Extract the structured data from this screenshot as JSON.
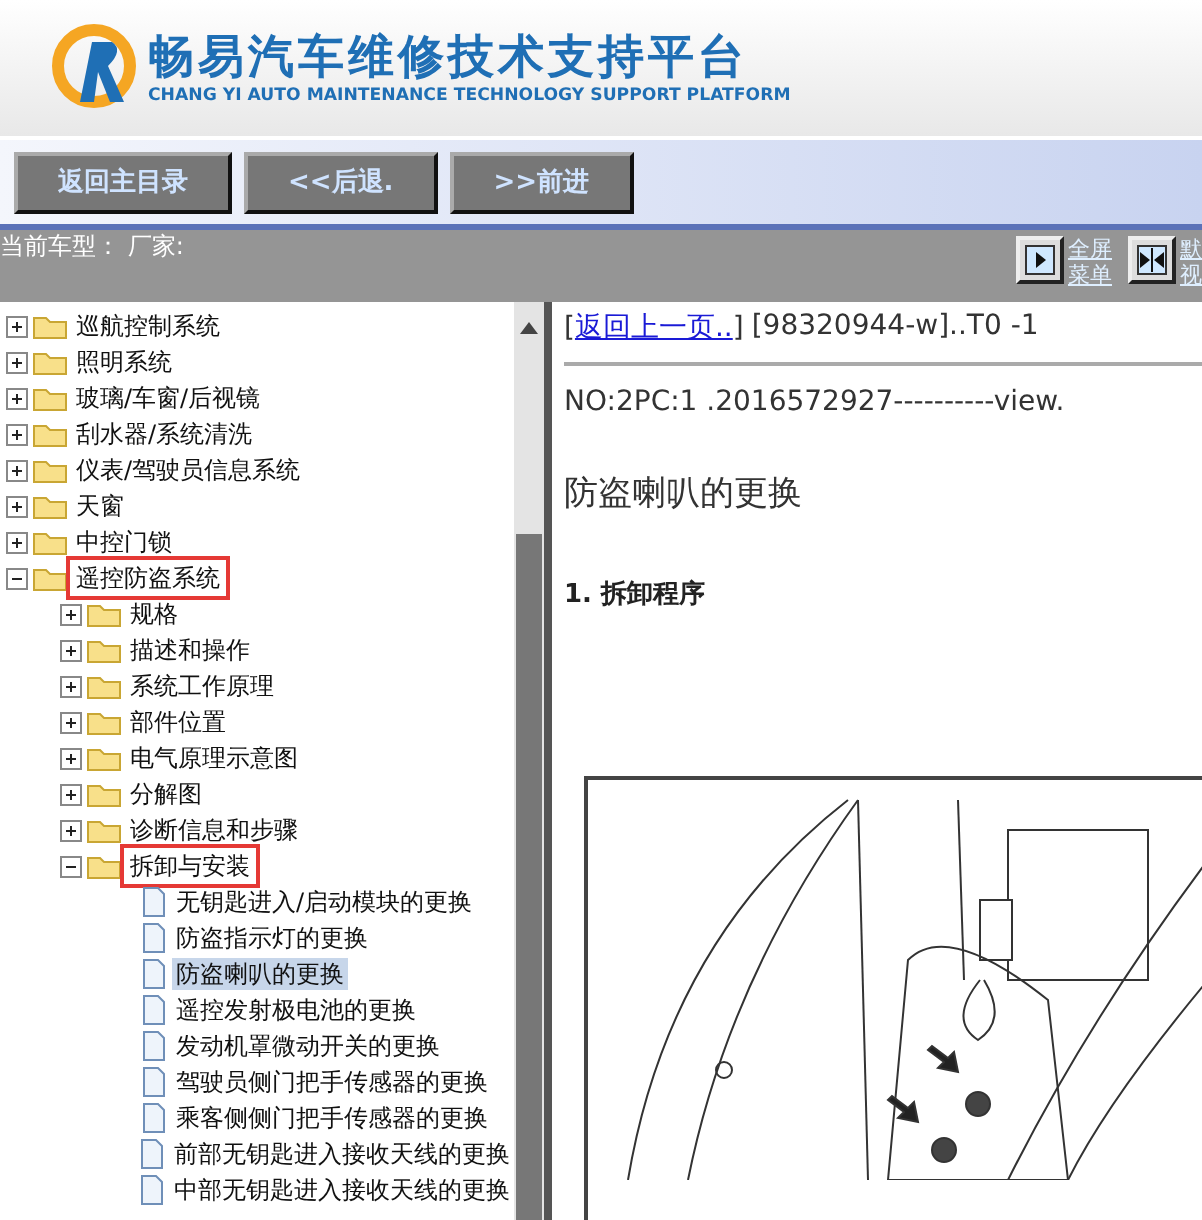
{
  "header": {
    "title": "畅易汽车维修技术支持平台",
    "subtitle": "CHANG YI AUTO MAINTENANCE TECHNOLOGY SUPPORT PLATFORM"
  },
  "toolbar": {
    "buttons": [
      "返回主目录",
      "<<后退.",
      ">>前进"
    ]
  },
  "info_bar": {
    "label": "当前车型： 厂家:",
    "view_buttons": [
      {
        "kind": "single",
        "lines": [
          "全屏",
          "菜单"
        ]
      },
      {
        "kind": "double",
        "lines": [
          "默",
          "视"
        ]
      }
    ]
  },
  "tree": [
    {
      "label": "巡航控制系统",
      "kind": "folder",
      "expanded": false,
      "marked": false,
      "selected": false
    },
    {
      "label": "照明系统",
      "kind": "folder",
      "expanded": false,
      "marked": false,
      "selected": false
    },
    {
      "label": "玻璃/车窗/后视镜",
      "kind": "folder",
      "expanded": false,
      "marked": false,
      "selected": false
    },
    {
      "label": "刮水器/系统清洗",
      "kind": "folder",
      "expanded": false,
      "marked": false,
      "selected": false
    },
    {
      "label": "仪表/驾驶员信息系统",
      "kind": "folder",
      "expanded": false,
      "marked": false,
      "selected": false
    },
    {
      "label": "天窗",
      "kind": "folder",
      "expanded": false,
      "marked": false,
      "selected": false
    },
    {
      "label": "中控门锁",
      "kind": "folder",
      "expanded": false,
      "marked": false,
      "selected": false
    },
    {
      "label": "遥控防盗系统",
      "kind": "folder",
      "expanded": true,
      "marked": true,
      "selected": false,
      "children": [
        {
          "label": "规格",
          "kind": "folder",
          "expanded": false,
          "marked": false,
          "selected": false
        },
        {
          "label": "描述和操作",
          "kind": "folder",
          "expanded": false,
          "marked": false,
          "selected": false
        },
        {
          "label": "系统工作原理",
          "kind": "folder",
          "expanded": false,
          "marked": false,
          "selected": false
        },
        {
          "label": "部件位置",
          "kind": "folder",
          "expanded": false,
          "marked": false,
          "selected": false
        },
        {
          "label": "电气原理示意图",
          "kind": "folder",
          "expanded": false,
          "marked": false,
          "selected": false
        },
        {
          "label": "分解图",
          "kind": "folder",
          "expanded": false,
          "marked": false,
          "selected": false
        },
        {
          "label": "诊断信息和步骤",
          "kind": "folder",
          "expanded": false,
          "marked": false,
          "selected": false
        },
        {
          "label": "拆卸与安装",
          "kind": "folder",
          "expanded": true,
          "marked": true,
          "selected": false,
          "children": [
            {
              "label": "无钥匙进入/启动模块的更换",
              "kind": "doc",
              "marked": false,
              "selected": false
            },
            {
              "label": "防盗指示灯的更换",
              "kind": "doc",
              "marked": false,
              "selected": false
            },
            {
              "label": "防盗喇叭的更换",
              "kind": "doc",
              "marked": false,
              "selected": true
            },
            {
              "label": "遥控发射极电池的更换",
              "kind": "doc",
              "marked": false,
              "selected": false
            },
            {
              "label": "发动机罩微动开关的更换",
              "kind": "doc",
              "marked": false,
              "selected": false
            },
            {
              "label": "驾驶员侧门把手传感器的更换",
              "kind": "doc",
              "marked": false,
              "selected": false
            },
            {
              "label": "乘客侧侧门把手传感器的更换",
              "kind": "doc",
              "marked": false,
              "selected": false
            },
            {
              "label": "前部无钥匙进入接收天线的更换",
              "kind": "doc",
              "marked": false,
              "selected": false
            },
            {
              "label": "中部无钥匙进入接收天线的更换",
              "kind": "doc",
              "marked": false,
              "selected": false
            }
          ]
        }
      ]
    }
  ],
  "content": {
    "back_link": {
      "open": "[",
      "text": "返回上一页..",
      "close": "]"
    },
    "doc_ref": "[98320944-w]..T0 -1",
    "number_line": "NO:2PC:1 .2016572927----------view.",
    "title": "防盗喇叭的更换",
    "section": "1. 拆卸程序"
  }
}
